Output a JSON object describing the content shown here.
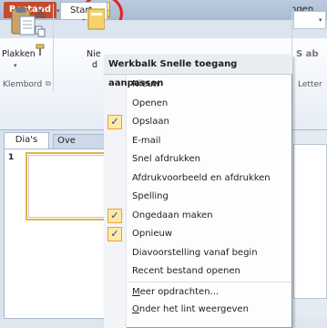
{
  "app": {
    "icon_letter": "P"
  },
  "tabs": {
    "file": "Bestand",
    "start": "Start",
    "partial": "ngen"
  },
  "ribbon": {
    "paste_label": "Plakken",
    "new_partial_1": "Nie",
    "new_partial_2": "d",
    "clipboard_group": "Klembord",
    "letter_group": "Letter",
    "font_glyph": "S ab"
  },
  "pane": {
    "tab_slides": "Dia's",
    "tab_outline": "Ove",
    "slide_number": "1"
  },
  "menu": {
    "header": "Werkbalk Snelle toegang aanpassen",
    "items": [
      {
        "label": "Nieuw",
        "checked": false
      },
      {
        "label": "Openen",
        "checked": false
      },
      {
        "label": "Opslaan",
        "checked": true
      },
      {
        "label": "E-mail",
        "checked": false
      },
      {
        "label": "Snel afdrukken",
        "checked": false
      },
      {
        "label": "Afdrukvoorbeeld en afdrukken",
        "checked": false
      },
      {
        "label": "Spelling",
        "checked": false
      },
      {
        "label": "Ongedaan maken",
        "checked": true
      },
      {
        "label": "Opnieuw",
        "checked": true
      },
      {
        "label": "Diavoorstelling vanaf begin",
        "checked": false
      },
      {
        "label": "Recent bestand openen",
        "checked": false
      }
    ],
    "more_commands": "Meer opdrachten...",
    "show_below_ribbon": "Onder het lint weergeven",
    "check_glyph": "✓"
  },
  "colors": {
    "file_tab": "#c44b2d",
    "highlight_circle": "#e22424",
    "check_fill": "#fde9a5"
  }
}
